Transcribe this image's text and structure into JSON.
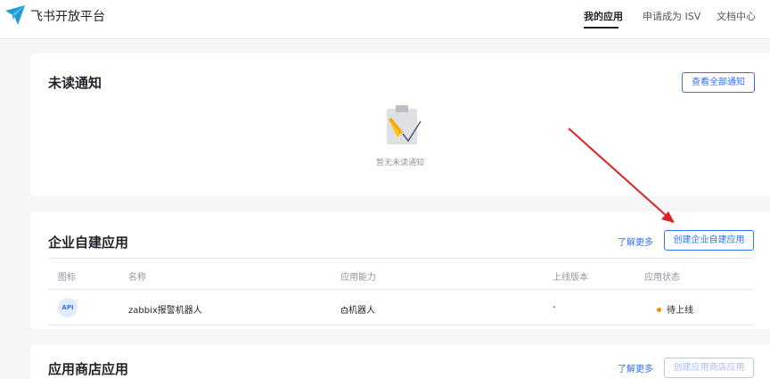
{
  "header": {
    "brand": "飞书开放平台",
    "nav": [
      {
        "label": "我的应用",
        "active": true
      },
      {
        "label": "申请成为 ISV",
        "active": false
      },
      {
        "label": "文档中心",
        "active": false
      }
    ]
  },
  "notifications": {
    "title": "未读通知",
    "view_all_button": "查看全部通知",
    "empty_text": "暂无未读通知"
  },
  "custom_apps": {
    "title": "企业自建应用",
    "learn_more": "了解更多",
    "create_button": "创建企业自建应用",
    "columns": [
      "图标",
      "名称",
      "应用能力",
      "上线版本",
      "应用状态"
    ],
    "rows": [
      {
        "icon_text": "API",
        "name": "zabbix报警机器人",
        "capability_icon": "robot-icon",
        "capability": "机器人",
        "version": "-",
        "status": "待上线",
        "status_color": "#ff8800"
      }
    ]
  },
  "store_apps": {
    "title": "应用商店应用",
    "learn_more": "了解更多",
    "create_button": "创建应用商店应用"
  },
  "colors": {
    "accent": "#3370ff",
    "annotation_arrow": "#e02020"
  }
}
